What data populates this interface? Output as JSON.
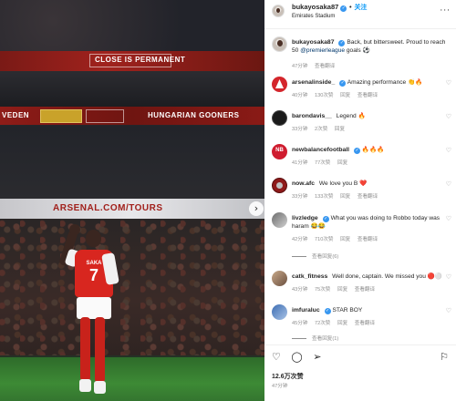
{
  "photo": {
    "ad_banners": [
      "CLOSE IS PERMANENT",
      "VEDEN",
      "HUNGARIAN GOONERS",
      "ARSENAL.COM/TOURS"
    ],
    "player_name": "SAKA",
    "player_number": "7"
  },
  "header": {
    "username": "bukayosaka87",
    "follow_label": "关注",
    "location": "Emirates Stadium"
  },
  "caption": {
    "username": "bukayosaka87",
    "text": "Back, but bittersweet. Proud to reach 50",
    "mention": "@premierleague",
    "text_after": " goals ⚽",
    "time": "47分钟",
    "translate": "查看翻译"
  },
  "comments": [
    {
      "username": "arsenalinside_",
      "verified": true,
      "text": "Amazing performance 👏🔥",
      "time": "40分钟",
      "likes": "130次赞",
      "reply": "回复",
      "translate": "查看翻译"
    },
    {
      "username": "barondavis__",
      "verified": false,
      "text": "Legend 🔥",
      "time": "33分钟",
      "likes": "2次赞",
      "reply": "回复"
    },
    {
      "username": "newbalancefootball",
      "verified": true,
      "text": "🔥🔥🔥",
      "time": "41分钟",
      "likes": "77次赞",
      "reply": "回复"
    },
    {
      "username": "now.afc",
      "verified": false,
      "text": "We love you B ❤️",
      "time": "33分钟",
      "likes": "133次赞",
      "reply": "回复",
      "translate": "查看翻译"
    },
    {
      "username": "livzledge",
      "verified": true,
      "text": "What you was doing to Robbo today was haram 😂😂",
      "time": "42分钟",
      "likes": "710次赞",
      "reply": "回复",
      "translate": "查看翻译",
      "view_replies": "查看回复(6)"
    },
    {
      "username": "catk_fitness",
      "verified": false,
      "text": "Well done, captain. We missed you 🔴⚪",
      "time": "43分钟",
      "likes": "75次赞",
      "reply": "回复",
      "translate": "查看翻译"
    },
    {
      "username": "imfuraluc",
      "verified": true,
      "text": "STAR BOY",
      "time": "45分钟",
      "likes": "72次赞",
      "reply": "回复",
      "translate": "查看翻译",
      "view_replies": "查看回复(1)"
    }
  ],
  "actions": {
    "likes": "12.6万次赞",
    "time": "47分钟"
  }
}
